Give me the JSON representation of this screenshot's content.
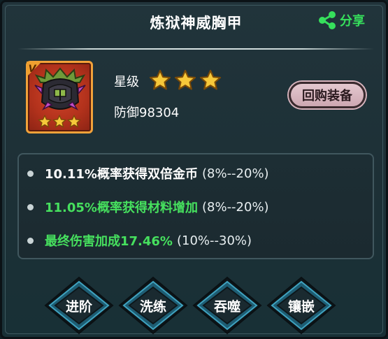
{
  "header": {
    "title": "炼狱神威胸甲",
    "share_label": "分享"
  },
  "item": {
    "tier_badge": "V",
    "slot_stars": 3,
    "star_label": "星级",
    "star_count": 3,
    "defense_text": "防御98304",
    "buyback_label": "回购装备"
  },
  "attributes": [
    {
      "text": "10.11%概率获得双倍金币",
      "range": "(8%--20%)",
      "color": "#ffffff"
    },
    {
      "text": "11.05%概率获得材料增加",
      "range": "(8%--20%)",
      "color": "#46e05e"
    },
    {
      "text": "最终伤害加成17.46%",
      "range": "(10%--30%)",
      "color": "#46e05e"
    }
  ],
  "actions": [
    {
      "label": "进阶"
    },
    {
      "label": "洗练"
    },
    {
      "label": "吞噬"
    },
    {
      "label": "镶嵌"
    }
  ],
  "colors": {
    "accent_green": "#46e05e",
    "star_gold": "#f6c83a",
    "slot_frame": "#f2a23a",
    "slot_fill": "#c23a22"
  }
}
